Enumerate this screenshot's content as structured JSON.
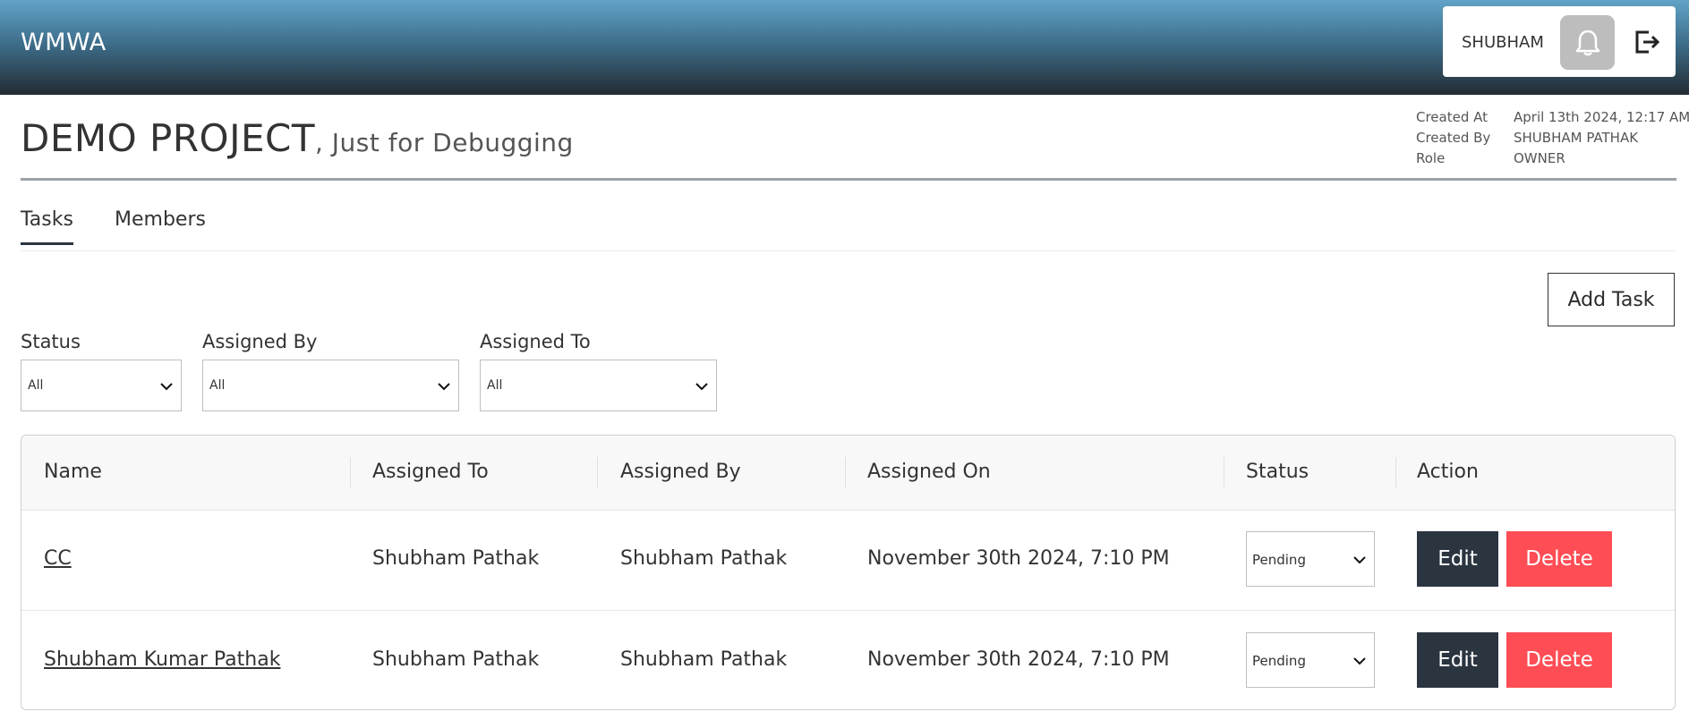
{
  "app": {
    "brand": "WMWA"
  },
  "user": {
    "name": "SHUBHAM"
  },
  "icons": {
    "notifications": "bell-icon",
    "logout": "logout-icon",
    "dropdown": "chevron-down-icon"
  },
  "project": {
    "title": "DEMO PROJECT",
    "subtitle": ", Just for Debugging",
    "meta": [
      {
        "label": "Created At",
        "value": "April 13th 2024, 12:17 AM"
      },
      {
        "label": "Created By",
        "value": "SHUBHAM PATHAK"
      },
      {
        "label": "Role",
        "value": "OWNER"
      }
    ]
  },
  "tabs": [
    {
      "label": "Tasks",
      "active": true
    },
    {
      "label": "Members",
      "active": false
    }
  ],
  "add_task_label": "Add Task",
  "filters": [
    {
      "label": "Status",
      "value": "All"
    },
    {
      "label": "Assigned By",
      "value": "All"
    },
    {
      "label": "Assigned To",
      "value": "All"
    }
  ],
  "table": {
    "columns": [
      "Name",
      "Assigned To",
      "Assigned By",
      "Assigned On",
      "Status",
      "Action"
    ],
    "rows": [
      {
        "name": "CC",
        "assigned_to": "Shubham Pathak",
        "assigned_by": "Shubham Pathak",
        "assigned_on": "November 30th 2024, 7:10 PM",
        "status": "Pending",
        "edit": "Edit",
        "delete": "Delete"
      },
      {
        "name": "Shubham Kumar Pathak",
        "assigned_to": "Shubham Pathak",
        "assigned_by": "Shubham Pathak",
        "assigned_on": "November 30th 2024, 7:10 PM",
        "status": "Pending",
        "edit": "Edit",
        "delete": "Delete"
      }
    ]
  },
  "colors": {
    "edit_button": "#2b3540",
    "delete_button": "#ff4d55",
    "header_top": "#62a3c7",
    "header_bottom": "#232b33"
  }
}
